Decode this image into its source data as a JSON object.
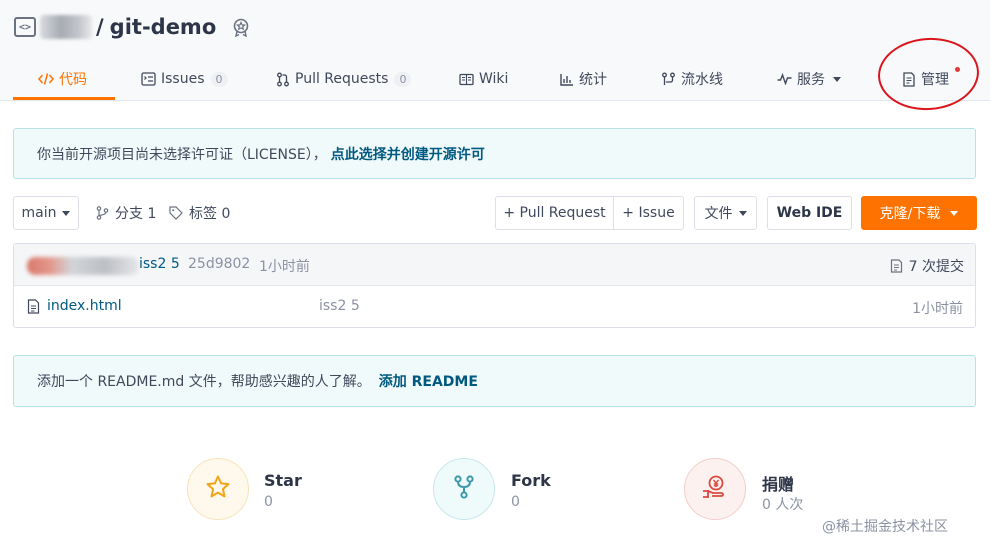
{
  "repo": {
    "separator": "/",
    "name": "git-demo"
  },
  "tabs": [
    {
      "label": "代码",
      "icon": "code-icon",
      "active": true
    },
    {
      "label": "Issues",
      "count": "0",
      "icon": "issues-icon"
    },
    {
      "label": "Pull Requests",
      "count": "0",
      "icon": "pull-request-icon"
    },
    {
      "label": "Wiki",
      "icon": "wiki-book-icon"
    },
    {
      "label": "统计",
      "icon": "stats-bar-chart-icon"
    },
    {
      "label": "流水线",
      "icon": "pipeline-icon"
    },
    {
      "label": "服务",
      "icon": "service-pulse-icon"
    },
    {
      "label": "管理",
      "icon": "manage-doc-icon"
    }
  ],
  "license_notice": {
    "text": "你当前开源项目尚未选择许可证（LICENSE），",
    "link": "点此选择并创建开源许可"
  },
  "toolbar": {
    "branch": "main",
    "branches_label": "分支 1",
    "tags_label": "标签 0",
    "pull_request_button": "+ Pull Request",
    "issue_button": "+ Issue",
    "file_button": "文件",
    "web_ide_button": "Web IDE",
    "clone_button": "克隆/下载"
  },
  "commit": {
    "message": "iss2 5",
    "sha": "25d9802",
    "time": "1小时前",
    "commits_label": "7 次提交"
  },
  "files": [
    {
      "name": "index.html",
      "commit_message": "iss2 5",
      "time": "1小时前"
    }
  ],
  "readme_notice": {
    "text": "添加一个 README.md 文件，帮助感兴趣的人了解。",
    "link": "添加 README"
  },
  "stats": [
    {
      "label": "Star",
      "value": "0",
      "icon": "star-icon"
    },
    {
      "label": "Fork",
      "value": "0",
      "icon": "fork-icon"
    },
    {
      "label": "捐赠",
      "value": "0 人次",
      "icon": "donate-yen-icon"
    }
  ],
  "watermark": "@稀土掘金技术社区",
  "colors": {
    "accent_orange": "#fe7300",
    "link_blue": "#005980",
    "notice_bg": "#f1fafb",
    "annotation_red": "#d9161c"
  }
}
